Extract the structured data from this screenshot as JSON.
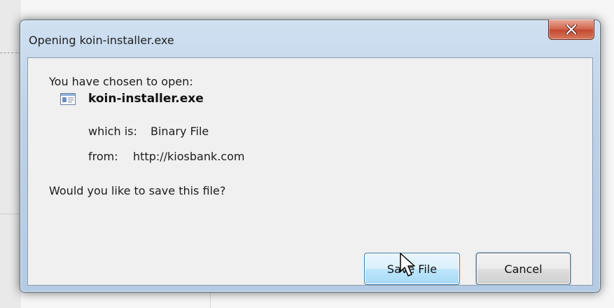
{
  "window": {
    "title": "Opening koin-installer.exe",
    "close_icon": "close-x-icon"
  },
  "dialog": {
    "prompt": "You have chosen to open:",
    "file_icon": "executable-file-icon",
    "file_name": "koin-installer.exe",
    "type_label": "which is:",
    "type_value": "Binary File",
    "from_label": "from:",
    "from_value": "http://kiosbank.com",
    "question": "Would you like to save this file?"
  },
  "buttons": {
    "save_label": "Save File",
    "cancel_label": "Cancel"
  },
  "colors": {
    "close_button": "#c7503a",
    "save_button_border": "#3c7fb1",
    "frame": "#bcd1e8"
  }
}
